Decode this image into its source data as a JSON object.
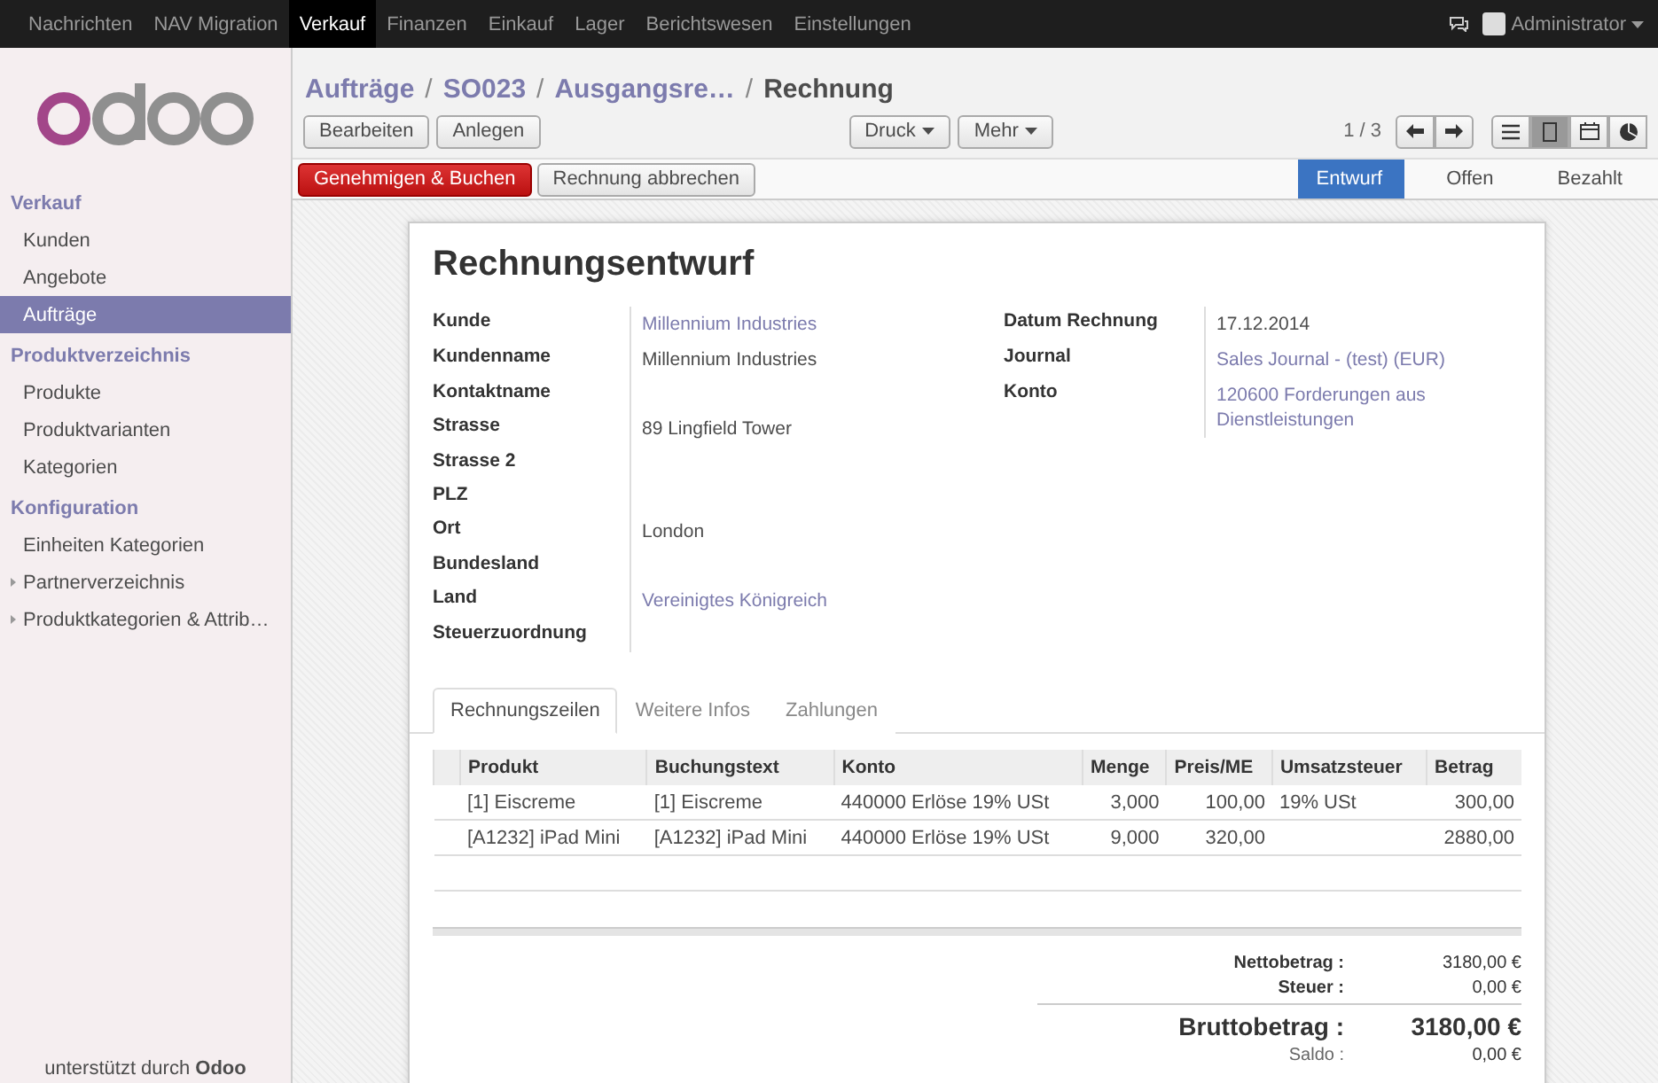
{
  "top_menu": [
    {
      "label": "Nachrichten",
      "selected": false
    },
    {
      "label": "NAV Migration",
      "selected": false
    },
    {
      "label": "Verkauf",
      "selected": true
    },
    {
      "label": "Finanzen",
      "selected": false
    },
    {
      "label": "Einkauf",
      "selected": false
    },
    {
      "label": "Lager",
      "selected": false
    },
    {
      "label": "Berichtswesen",
      "selected": false
    },
    {
      "label": "Einstellungen",
      "selected": false
    }
  ],
  "user": {
    "name": "Administrator"
  },
  "sidebar": {
    "sections": [
      {
        "title": "Verkauf",
        "items": [
          {
            "label": "Kunden",
            "selected": false,
            "expandable": false
          },
          {
            "label": "Angebote",
            "selected": false,
            "expandable": false
          },
          {
            "label": "Aufträge",
            "selected": true,
            "expandable": false
          }
        ]
      },
      {
        "title": "Produktverzeichnis",
        "items": [
          {
            "label": "Produkte",
            "selected": false,
            "expandable": false
          },
          {
            "label": "Produktvarianten",
            "selected": false,
            "expandable": false
          },
          {
            "label": "Kategorien",
            "selected": false,
            "expandable": false
          }
        ]
      },
      {
        "title": "Konfiguration",
        "items": [
          {
            "label": "Einheiten Kategorien",
            "selected": false,
            "expandable": false
          },
          {
            "label": "Partnerverzeichnis",
            "selected": false,
            "expandable": true
          },
          {
            "label": "Produktkategorien & Attrib…",
            "selected": false,
            "expandable": true
          }
        ]
      }
    ],
    "footer": "unterstützt durch **Odoo**"
  },
  "breadcrumb_separator": "/",
  "breadcrumb": [
    {
      "label": "Aufträge",
      "kind": "link"
    },
    {
      "label": "SO023",
      "kind": "link"
    },
    {
      "label": "Ausgangsre…",
      "kind": "link"
    },
    {
      "label": "Rechnung",
      "kind": "current"
    }
  ],
  "toolbar": {
    "left_buttons": [
      "Bearbeiten",
      "Anlegen"
    ],
    "dropdowns": [
      "Druck",
      "Mehr"
    ],
    "pager": "1 / 3",
    "views": [
      {
        "kind": "list",
        "selected": false
      },
      {
        "kind": "form",
        "selected": true
      },
      {
        "kind": "calendar",
        "selected": false
      },
      {
        "kind": "graph",
        "selected": false
      }
    ]
  },
  "actions": [
    {
      "label": "Genehmigen & Buchen",
      "kind": "primary"
    },
    {
      "label": "Rechnung abbrechen",
      "kind": "default"
    }
  ],
  "status_steps": [
    {
      "label": "Entwurf",
      "selected": true
    },
    {
      "label": "Offen",
      "selected": false
    },
    {
      "label": "Bezahlt",
      "selected": false
    }
  ],
  "sheet": {
    "title": "Rechnungsentwurf",
    "left_fields": [
      {
        "label": "Kunde",
        "value": "Millennium Industries",
        "kind": "link"
      },
      {
        "label": "Kundenname",
        "value": "Millennium Industries",
        "kind": "text"
      },
      {
        "label": "Kontaktname"
      },
      {
        "label": "Strasse",
        "value": "89 Lingfield Tower",
        "kind": "text"
      },
      {
        "label": "Strasse 2"
      },
      {
        "label": "PLZ"
      },
      {
        "label": "Ort",
        "value": "London",
        "kind": "text"
      },
      {
        "label": "Bundesland"
      },
      {
        "label": "Land",
        "value": "Vereinigtes Königreich",
        "kind": "link"
      },
      {
        "label": "Steuerzuordnung"
      }
    ],
    "right_fields": [
      {
        "label": "Datum Rechnung",
        "value": "17.12.2014",
        "kind": "text"
      },
      {
        "label": "Journal",
        "value": "Sales Journal - (test) (EUR)",
        "kind": "link"
      },
      {
        "label": "Konto",
        "value": "120600 Forderungen aus Dienstleistungen",
        "kind": "link"
      }
    ],
    "tabs": [
      {
        "label": "Rechnungszeilen",
        "selected": true
      },
      {
        "label": "Weitere Infos",
        "selected": false
      },
      {
        "label": "Zahlungen",
        "selected": false
      }
    ],
    "table": {
      "columns": [
        {
          "label": "Produkt",
          "kind": "text"
        },
        {
          "label": "Buchungstext",
          "kind": "text"
        },
        {
          "label": "Konto",
          "kind": "text"
        },
        {
          "label": "Menge",
          "kind": "number"
        },
        {
          "label": "Preis/ME",
          "kind": "number"
        },
        {
          "label": "Umsatzsteuer",
          "kind": "text"
        },
        {
          "label": "Betrag",
          "kind": "number"
        }
      ],
      "rows": [
        [
          "[1] Eiscreme",
          "[1] Eiscreme",
          "440000 Erlöse 19% USt",
          "3,000",
          "100,00",
          "19% USt",
          "300,00"
        ],
        [
          "[A1232] iPad Mini",
          "[A1232] iPad Mini",
          "440000 Erlöse 19% USt",
          "9,000",
          "320,00",
          "",
          "2880,00"
        ]
      ]
    },
    "totals": [
      {
        "label": "Nettobetrag :",
        "value": "3180,00 €",
        "kind": "normal"
      },
      {
        "label": "Steuer :",
        "value": "0,00 €",
        "kind": "normal"
      },
      {
        "label": "Bruttobetrag :",
        "value": "3180,00 €",
        "kind": "grand"
      },
      {
        "label": "Saldo :",
        "value": "0,00 €",
        "kind": "muted"
      }
    ]
  }
}
